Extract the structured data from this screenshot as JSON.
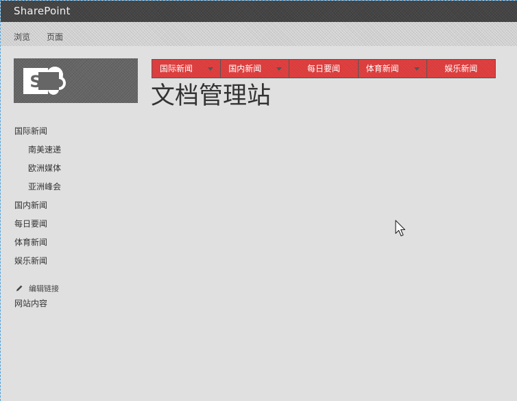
{
  "suite_bar": {
    "brand": "SharePoint"
  },
  "ribbon": {
    "tabs": [
      {
        "label": "浏览"
      },
      {
        "label": "页面"
      }
    ]
  },
  "logo": {
    "icon": "sharepoint-logo-icon",
    "background": "#666666"
  },
  "top_nav": {
    "background": "#e04040",
    "items": [
      {
        "label": "国际新闻",
        "has_dropdown": true
      },
      {
        "label": "国内新闻",
        "has_dropdown": true
      },
      {
        "label": "每日要闻",
        "has_dropdown": false
      },
      {
        "label": "体育新闻",
        "has_dropdown": true
      },
      {
        "label": "娱乐新闻",
        "has_dropdown": false
      }
    ]
  },
  "site_title": "文档管理站",
  "quick_launch": {
    "items": [
      {
        "label": "国际新闻"
      },
      {
        "label": "南美速递"
      },
      {
        "label": "欧洲媒体"
      },
      {
        "label": "亚洲峰会"
      },
      {
        "label": "国内新闻"
      },
      {
        "label": "每日要闻"
      },
      {
        "label": "体育新闻"
      },
      {
        "label": "娱乐新闻"
      }
    ],
    "edit_links_label": "编辑链接",
    "site_contents_label": "网站内容"
  }
}
